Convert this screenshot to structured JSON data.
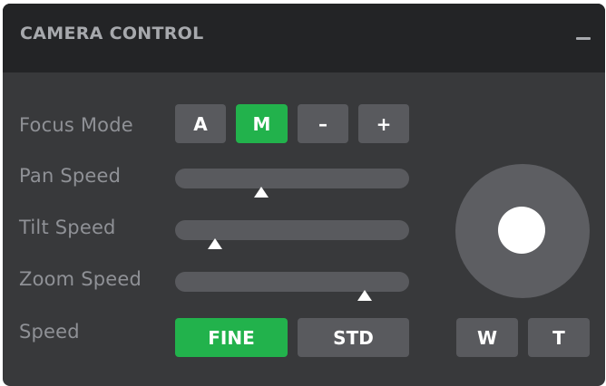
{
  "panel": {
    "title": "CAMERA CONTROL",
    "collapse_label": "–"
  },
  "controls": {
    "focus_mode": {
      "label": "Focus Mode",
      "buttons": [
        "A",
        "M",
        "–",
        "+"
      ],
      "active": "M"
    },
    "pan_speed": {
      "label": "Pan Speed",
      "level": 0.37
    },
    "tilt_speed": {
      "label": "Tilt Speed",
      "level": 0.17
    },
    "zoom_speed": {
      "label": "Zoom Speed",
      "level": 0.81
    },
    "speed": {
      "label": "Speed",
      "options": [
        "FINE",
        "STD"
      ],
      "active": "FINE"
    }
  },
  "zoom": {
    "wide_label": "W",
    "tele_label": "T"
  },
  "colors": {
    "panel_bg": "#38393b",
    "header_bg": "#232426",
    "button_bg": "#595a5e",
    "active_green": "#22b24c",
    "label_text": "#8f9196"
  },
  "icons": {
    "collapse": "minus-icon",
    "slider_thumb": "triangle-up-icon",
    "joystick_knob": "circle-icon"
  }
}
